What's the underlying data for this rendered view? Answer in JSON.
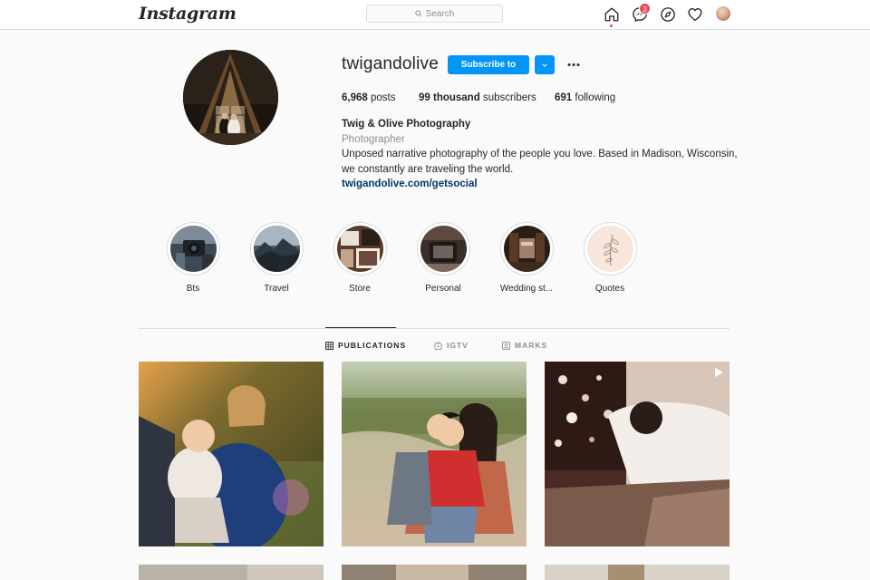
{
  "nav": {
    "logo": "Instagram",
    "search_placeholder": "Search",
    "messages_badge": "3",
    "icons": [
      "home-icon",
      "messenger-icon",
      "explore-icon",
      "activity-heart-icon",
      "profile-avatar"
    ]
  },
  "profile": {
    "username": "twigandolive",
    "follow_button": "Subscribe to",
    "stats": {
      "posts_count": "6,968",
      "posts_label": "posts",
      "subscribers_count": "99 thousand",
      "subscribers_label": "subscribers",
      "following_count": "691",
      "following_label": "following"
    },
    "bio": {
      "name": "Twig & Olive Photography",
      "category": "Photographer",
      "line1": "Unposed narrative photography of the people you love. Based in Madison, Wisconsin,",
      "line2": "we constantly are traveling the world.",
      "link": "twigandolive.com/getsocial"
    }
  },
  "highlights": [
    {
      "label": "Bts"
    },
    {
      "label": "Travel"
    },
    {
      "label": "Store"
    },
    {
      "label": "Personal"
    },
    {
      "label": "Wedding st..."
    },
    {
      "label": "Quotes"
    }
  ],
  "tabs": [
    {
      "label": "PUBLICATIONS",
      "active": true
    },
    {
      "label": "IGTV",
      "active": false
    },
    {
      "label": "MARKS",
      "active": false
    }
  ],
  "colors": {
    "accent": "#0095f6",
    "badge": "#ed4956",
    "link": "#00376b",
    "muted": "#8e8e8e"
  }
}
